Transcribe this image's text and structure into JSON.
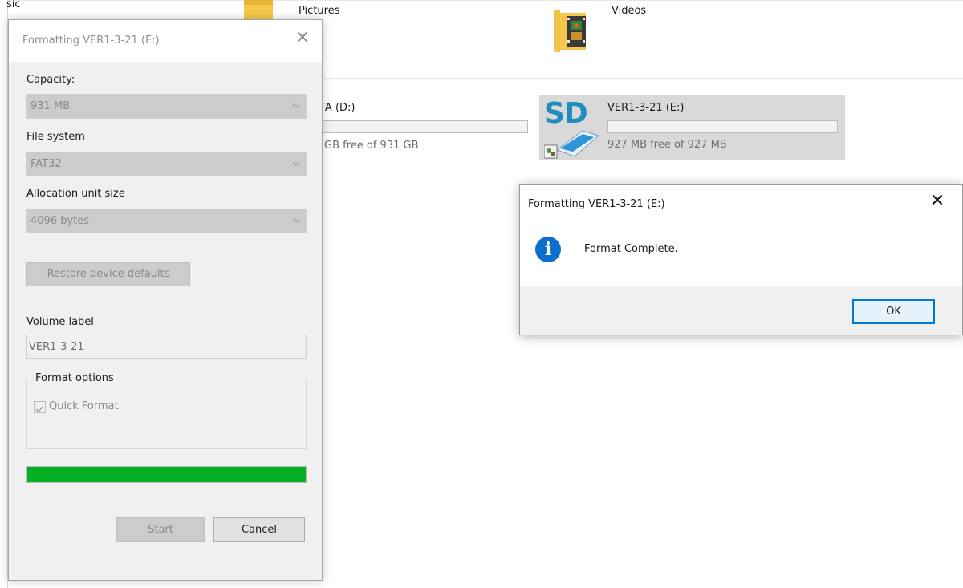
{
  "explorer": {
    "music_label": "sic",
    "pictures_label": "Pictures",
    "videos_label": "Videos",
    "drive_d_label": "TA (D:)",
    "drive_d_space": "GB free of 931 GB",
    "drive_e_badge": "SD",
    "drive_e_label": "VER1-3-21 (E:)",
    "drive_e_space": "927 MB free of 927 MB"
  },
  "format_dialog": {
    "title": "Formatting VER1-3-21 (E:)",
    "close_glyph": "✕",
    "capacity_label": "Capacity:",
    "capacity_value": "931 MB",
    "filesystem_label": "File system",
    "filesystem_value": "FAT32",
    "allocation_label": "Allocation unit size",
    "allocation_value": "4096 bytes",
    "restore_button": "Restore device defaults",
    "volume_label_label": "Volume label",
    "volume_label_value": "VER1-3-21",
    "format_options_title": "Format options",
    "quick_format_label": "Quick Format",
    "quick_format_checked": true,
    "progress_fraction": 1.0,
    "start_button": "Start",
    "cancel_button": "Cancel"
  },
  "message_box": {
    "title": "Formatting VER1-3-21 (E:)",
    "close_glyph": "✕",
    "icon_glyph": "i",
    "message": "Format Complete.",
    "ok_button": "OK"
  },
  "colors": {
    "progress_green": "#06b025",
    "info_blue": "#0d6fca",
    "sd_blue": "#1f8ebf",
    "ok_border": "#0078d7"
  }
}
